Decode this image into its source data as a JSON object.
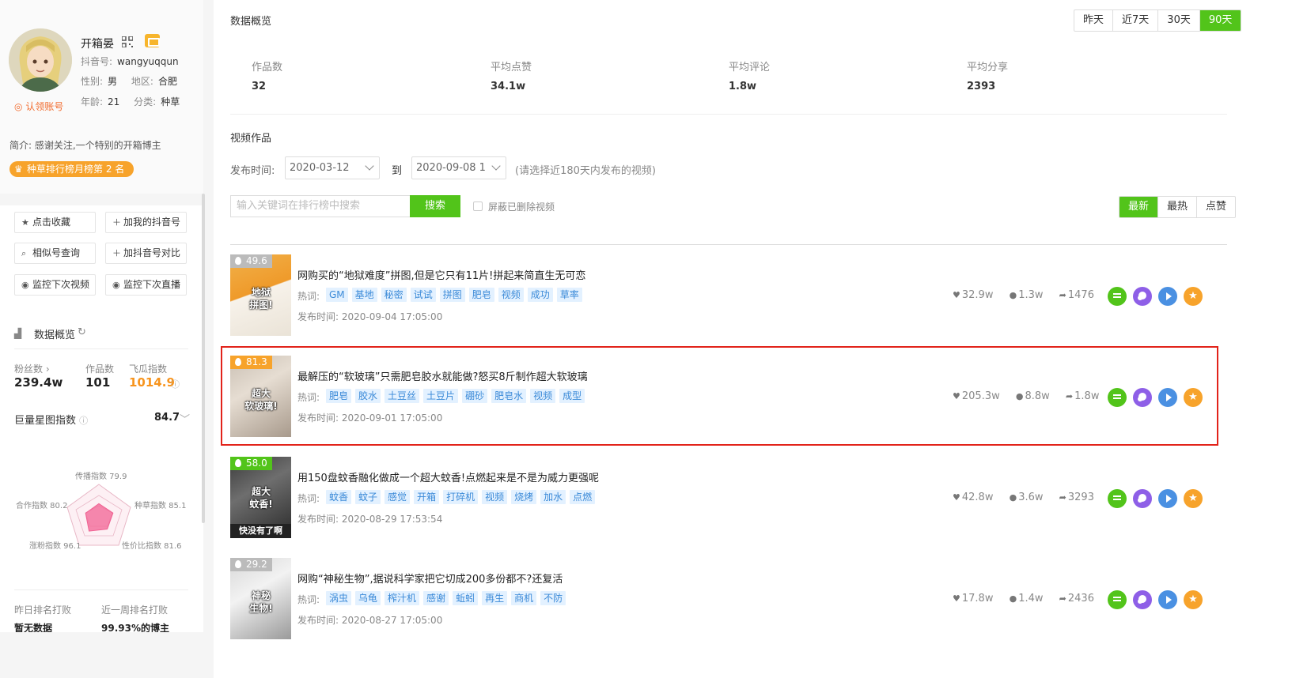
{
  "profile": {
    "name": "开箱晏",
    "douyin_id_label": "抖音号:",
    "douyin_id": "wangyuqqun",
    "gender_label": "性别:",
    "gender": "男",
    "region_label": "地区:",
    "region": "合肥",
    "age_label": "年龄:",
    "age": "21",
    "category_label": "分类:",
    "category": "种草",
    "claim": "认领账号",
    "intro": "简介: 感谢关注,一个特别的开箱博主",
    "rank_badge": "种草排行榜月榜第 2 名"
  },
  "sidebar_actions": [
    {
      "label": "点击收藏",
      "icon": "star-icon"
    },
    {
      "label": "加我的抖音号",
      "icon": "plus-icon"
    },
    {
      "label": "相似号查询",
      "icon": "search-icon"
    },
    {
      "label": "加抖音号对比",
      "icon": "plus-icon"
    },
    {
      "label": "监控下次视频",
      "icon": "eye-icon"
    },
    {
      "label": "监控下次直播",
      "icon": "eye-icon"
    }
  ],
  "sidebar_stats": {
    "title": "数据概览",
    "fans_label": "粉丝数",
    "fans_value": "239.4w",
    "works_label": "作品数",
    "works_value": "101",
    "feigua_label": "飞瓜指数",
    "feigua_value": "1014.9",
    "star_label": "巨量星图指数",
    "star_value": "84.7",
    "radar": {
      "top": "传播指数 79.9",
      "left": "合作指数 80.2",
      "right": "种草指数 85.1",
      "bottom_left": "涨粉指数 96.1",
      "bottom_right": "性价比指数 81.6",
      "values": [
        79.9,
        85.1,
        81.6,
        96.1,
        80.2
      ]
    },
    "yesterday_label": "昨日排名打败",
    "yesterday_value": "暂无数据",
    "week_label": "近一周排名打败",
    "week_value": "99.93%的博主"
  },
  "overview": {
    "title": "数据概览",
    "ranges": [
      "昨天",
      "近7天",
      "30天",
      "90天"
    ],
    "active_range": "90天",
    "metrics": [
      {
        "label": "作品数",
        "value": "32"
      },
      {
        "label": "平均点赞",
        "value": "34.1w"
      },
      {
        "label": "平均评论",
        "value": "1.8w"
      },
      {
        "label": "平均分享",
        "value": "2393"
      }
    ]
  },
  "videos_section": {
    "title": "视频作品",
    "publish_label": "发布时间:",
    "date_from": "2020-03-12",
    "to_label": "到",
    "date_to": "2020-09-08 1",
    "date_hint": "(请选择近180天内发布的视频)",
    "search_placeholder": "输入关键词在排行榜中搜索",
    "search_button": "搜索",
    "hide_deleted": "屏蔽已删除视频",
    "sorts": [
      "最新",
      "最热",
      "点赞"
    ],
    "active_sort": "最新",
    "hot_label": "热词:",
    "time_label": "发布时间:"
  },
  "videos": [
    {
      "score": "49.6",
      "score_color": "#bbbbbb",
      "caption": "地狱\n拼图!",
      "sub": "",
      "title": "网购买的“地狱难度”拼图,但是它只有11片!拼起来简直生无可恋",
      "tags": [
        "GM",
        "基地",
        "秘密",
        "试试",
        "拼图",
        "肥皂",
        "视频",
        "成功",
        "草率"
      ],
      "time": "2020-09-04 17:05:00",
      "likes": "32.9w",
      "comments": "1.3w",
      "shares": "1476"
    },
    {
      "score": "81.3",
      "score_color": "#f7a32b",
      "caption": "超大\n软玻璃!",
      "sub": "",
      "title": "最解压的“软玻璃”只需肥皂胶水就能做?怒买8斤制作超大软玻璃",
      "tags": [
        "肥皂",
        "胶水",
        "土豆丝",
        "土豆片",
        "硼砂",
        "肥皂水",
        "视频",
        "成型"
      ],
      "time": "2020-09-01 17:05:00",
      "likes": "205.3w",
      "comments": "8.8w",
      "shares": "1.8w"
    },
    {
      "score": "58.0",
      "score_color": "#52c41a",
      "caption": "超大\n蚊香!",
      "sub": "快没有了啊",
      "title": "用150盘蚊香融化做成一个超大蚊香!点燃起来是不是为威力更强呢",
      "tags": [
        "蚊香",
        "蚊子",
        "感觉",
        "开箱",
        "打碎机",
        "视频",
        "烧烤",
        "加水",
        "点燃"
      ],
      "time": "2020-08-29 17:53:54",
      "likes": "42.8w",
      "comments": "3.6w",
      "shares": "3293"
    },
    {
      "score": "29.2",
      "score_color": "#bbbbbb",
      "caption": "神秘\n生物!",
      "sub": "",
      "title": "网购“神秘生物”,据说科学家把它切成200多份都不?还复活",
      "tags": [
        "涡虫",
        "乌龟",
        "榨汁机",
        "感谢",
        "蚯蚓",
        "再生",
        "商机",
        "不防"
      ],
      "time": "2020-08-27 17:05:00",
      "likes": "17.8w",
      "comments": "1.4w",
      "shares": "2436"
    }
  ]
}
